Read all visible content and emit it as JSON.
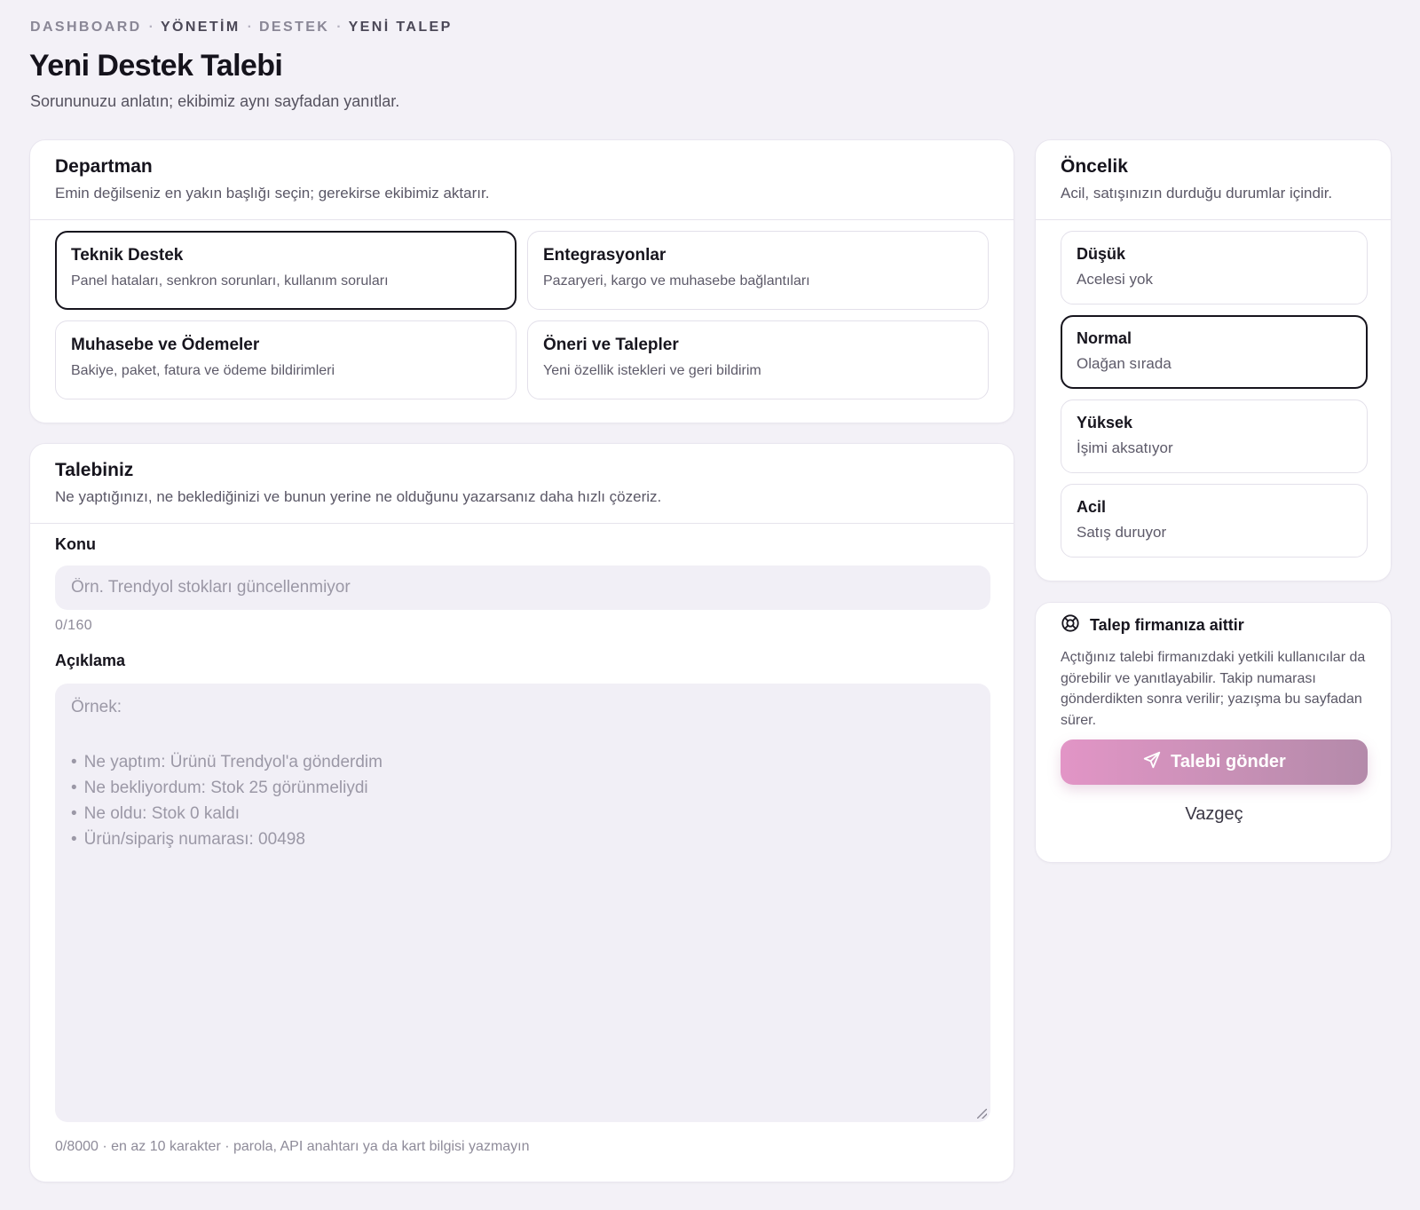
{
  "breadcrumb": {
    "items": [
      "DASHBOARD",
      "YÖNETİM",
      "DESTEK",
      "YENİ TALEP"
    ],
    "separator": "·"
  },
  "header": {
    "title": "Yeni Destek Talebi",
    "subtitle": "Sorununuzu anlatın; ekibimiz aynı sayfadan yanıtlar."
  },
  "department": {
    "title": "Departman",
    "description": "Emin değilseniz en yakın başlığı seçin; gerekirse ekibimiz aktarır.",
    "options": [
      {
        "title": "Teknik Destek",
        "desc": "Panel hataları, senkron sorunları, kullanım soruları",
        "selected": true
      },
      {
        "title": "Entegrasyonlar",
        "desc": "Pazaryeri, kargo ve muhasebe bağlantıları",
        "selected": false
      },
      {
        "title": "Muhasebe ve Ödemeler",
        "desc": "Bakiye, paket, fatura ve ödeme bildirimleri",
        "selected": false
      },
      {
        "title": "Öneri ve Talepler",
        "desc": "Yeni özellik istekleri ve geri bildirim",
        "selected": false
      }
    ]
  },
  "request": {
    "title": "Talebiniz",
    "description": "Ne yaptığınızı, ne beklediğinizi ve bunun yerine ne olduğunu yazarsanız daha hızlı çözeriz.",
    "subject_label": "Konu",
    "subject_value": "",
    "subject_placeholder": "Örn. Trendyol stokları güncellenmiyor",
    "subject_counter": "0/160",
    "desc_label": "Açıklama",
    "desc_placeholder_intro": "Örnek:",
    "desc_placeholder_items": [
      "Ne yaptım: Ürünü Trendyol'a gönderdim",
      "Ne bekliyordum: Stok 25 görünmeliydi",
      "Ne oldu: Stok 0 kaldı",
      "Ürün/sipariş numarası: 00498"
    ],
    "desc_hint": "0/8000 · en az 10 karakter · parola, API anahtarı ya da kart bilgisi yazmayın"
  },
  "priority": {
    "title": "Öncelik",
    "description": "Acil, satışınızın durduğu durumlar içindir.",
    "options": [
      {
        "title": "Düşük",
        "desc": "Acelesi yok",
        "selected": false
      },
      {
        "title": "Normal",
        "desc": "Olağan sırada",
        "selected": true
      },
      {
        "title": "Yüksek",
        "desc": "İşimi aksatıyor",
        "selected": false
      },
      {
        "title": "Acil",
        "desc": "Satış duruyor",
        "selected": false
      }
    ]
  },
  "info": {
    "icon": "lifebuoy-icon",
    "title": "Talep firmanıza aittir",
    "text": "Açtığınız talebi firmanızdaki yetkili kullanıcılar da görebilir ve yanıtlayabilir. Takip numarası gönderdikten sonra verilir; yazışma bu sayfadan sürer.",
    "submit_icon": "send-icon",
    "submit_label": "Talebi gönder",
    "cancel_label": "Vazgeç"
  },
  "colors": {
    "background": "#f3f1f7",
    "card": "#ffffff",
    "selected_border": "#16141d",
    "input_fill": "#f1eff6",
    "submit_gradient_start": "#e295c6",
    "submit_gradient_end": "#b48aaa"
  }
}
